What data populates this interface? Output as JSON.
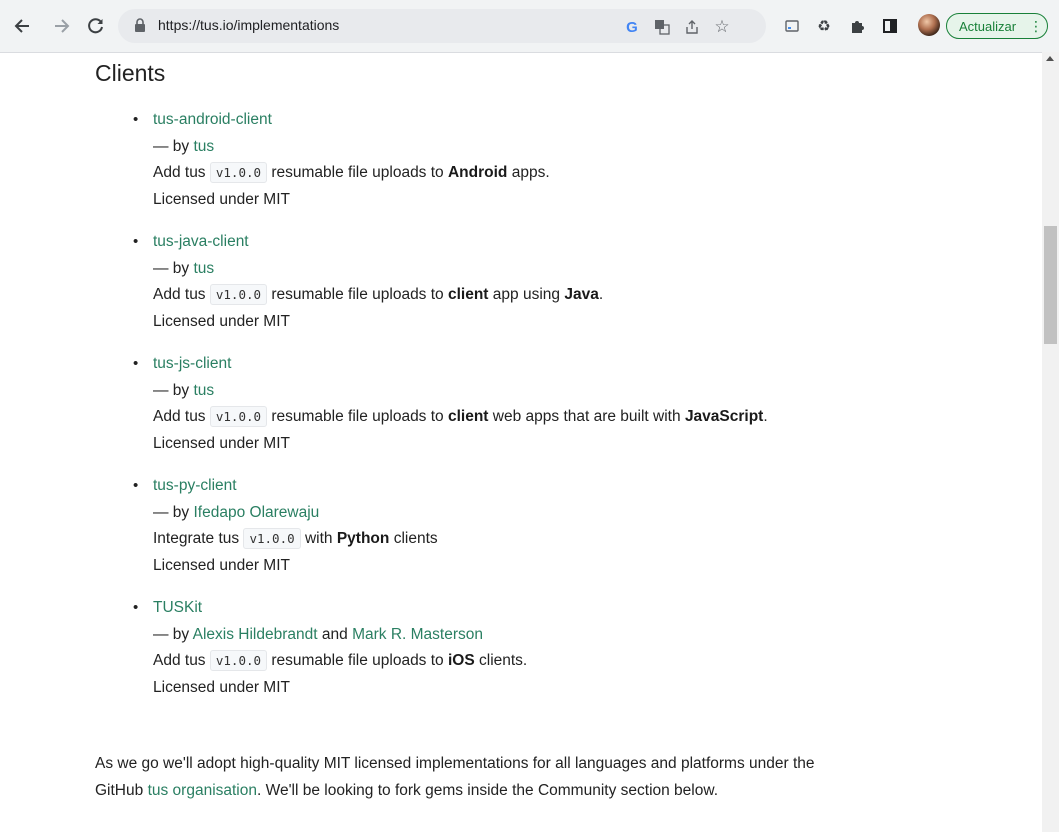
{
  "browser": {
    "url": "https://tus.io/implementations",
    "update_label": "Actualizar"
  },
  "page": {
    "heading": "Clients",
    "by_prefix": "— by",
    "and_word": "and",
    "add_prefix": "Add tus",
    "integrate_prefix": "Integrate tus",
    "license_text": "Licensed under MIT",
    "clients": [
      {
        "name": "tus-android-client",
        "authors": [
          "tus"
        ],
        "version": "v1.0.0",
        "desc_mid": "resumable file uploads to",
        "bold1": "Android",
        "desc_mid2": "apps.",
        "bold2": "",
        "desc_end": ""
      },
      {
        "name": "tus-java-client",
        "authors": [
          "tus"
        ],
        "version": "v1.0.0",
        "desc_mid": "resumable file uploads to",
        "bold1": "client",
        "desc_mid2": "app using",
        "bold2": "Java",
        "desc_end": "."
      },
      {
        "name": "tus-js-client",
        "authors": [
          "tus"
        ],
        "version": "v1.0.0",
        "desc_mid": "resumable file uploads to",
        "bold1": "client",
        "desc_mid2": "web apps that are built with",
        "bold2": "JavaScript",
        "desc_end": "."
      },
      {
        "name": "tus-py-client",
        "authors": [
          "Ifedapo Olarewaju"
        ],
        "version": "v1.0.0",
        "desc_mid": "with",
        "bold1": "Python",
        "desc_mid2": "clients",
        "bold2": "",
        "desc_end": ""
      },
      {
        "name": "TUSKit",
        "authors": [
          "Alexis Hildebrandt",
          "Mark R. Masterson"
        ],
        "version": "v1.0.0",
        "desc_mid": "resumable file uploads to",
        "bold1": "iOS",
        "desc_mid2": "clients.",
        "bold2": "",
        "desc_end": ""
      }
    ],
    "footer": {
      "text1": "As we go we'll adopt high-quality MIT licensed implementations for all languages and platforms under the",
      "text2_pre": "GitHub",
      "link": "tus organisation",
      "text2_post": ". We'll be looking to fork gems inside the Community section below."
    }
  }
}
